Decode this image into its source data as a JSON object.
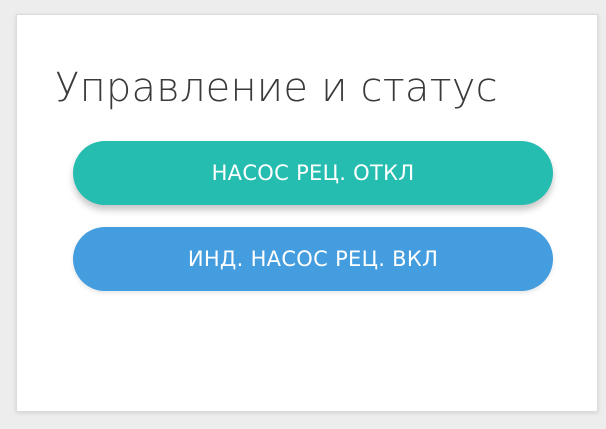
{
  "panel": {
    "title": "Управление и статус"
  },
  "buttons": {
    "pump_label": "НАСОС РЕЦ. ОТКЛ",
    "indicator_label": "ИНД. НАСОС РЕЦ. ВКЛ"
  },
  "colors": {
    "pump_button": "#26bdb1",
    "indicator_button": "#449dde"
  }
}
